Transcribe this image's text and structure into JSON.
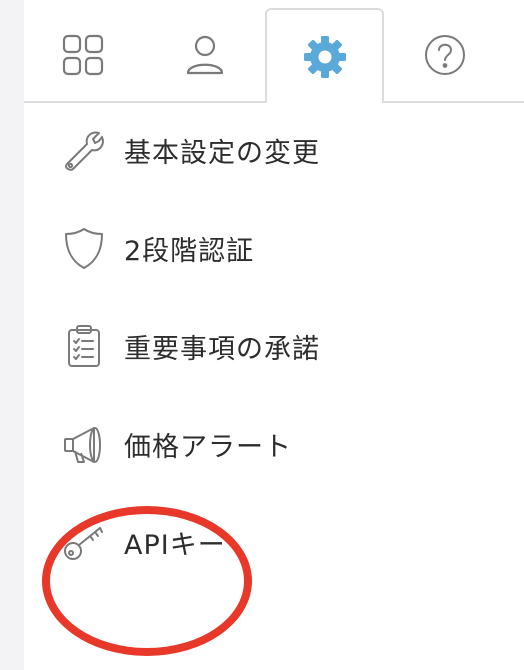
{
  "tabs": [
    {
      "icon": "grid-icon",
      "label": ""
    },
    {
      "icon": "user-icon",
      "label": ""
    },
    {
      "icon": "gear-icon",
      "label": "",
      "active": true
    },
    {
      "icon": "help-icon",
      "label": ""
    }
  ],
  "menu": {
    "items": [
      {
        "icon": "wrench-icon",
        "label": "基本設定の変更"
      },
      {
        "icon": "shield-icon",
        "label": "2段階認証"
      },
      {
        "icon": "clipboard-icon",
        "label": "重要事項の承諾"
      },
      {
        "icon": "megaphone-icon",
        "label": "価格アラート"
      },
      {
        "icon": "key-icon",
        "label": "APIキー"
      }
    ]
  },
  "colors": {
    "accent": "#5aa9d9",
    "icon": "#777777",
    "highlight": "#e8382a",
    "border": "#dcdcdc"
  }
}
